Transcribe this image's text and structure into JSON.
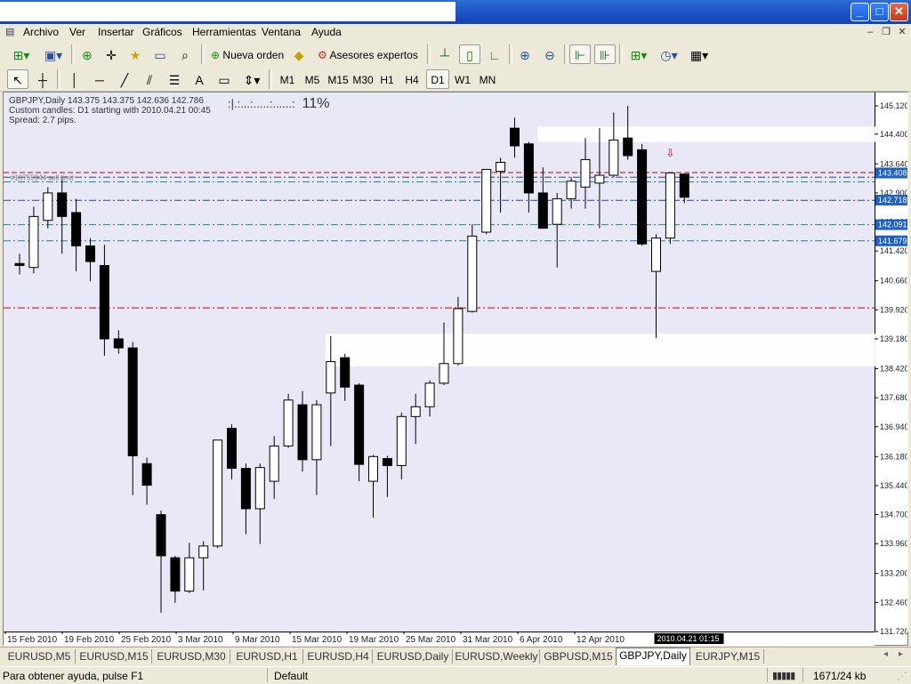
{
  "menu": [
    "Archivo",
    "Ver",
    "Insertar",
    "Gráficos",
    "Herramientas",
    "Ventana",
    "Ayuda"
  ],
  "toolbar": {
    "new_order": "Nueva orden",
    "experts": "Asesores expertos",
    "timeframes": [
      "M1",
      "M5",
      "M15",
      "M30",
      "H1",
      "H4",
      "D1",
      "W1",
      "MN"
    ],
    "active_timeframe": "D1",
    "text_tool": "A"
  },
  "chart": {
    "info_line1": "GBPJPY,Daily  143.375 143.375 142.636 142.786",
    "info_line2": "Custom candles: D1 starting with 2010.04.21 00:45",
    "info_line3": "Spread: 2.7 pips.",
    "progress_dots": ":|.:...:.....:......:",
    "progress_pct": "11%",
    "order_label": "#10755944 sell limit",
    "crosshair_time": "2010.04.21 01:15",
    "colors": {
      "background": "#e8e8f6",
      "bull": "#ffffff",
      "bear": "#000000",
      "red_line": "#cc0000",
      "teal_line": "#1a8a8a",
      "blue_line": "#2244aa",
      "highlight": "#2060c0",
      "zone": "#ffffff"
    }
  },
  "chart_data": {
    "type": "candlestick",
    "symbol": "GBPJPY",
    "timeframe": "Daily",
    "y_ticks": [
      "145.120",
      "144.400",
      "143.640",
      "142.900",
      "142.160",
      "141.420",
      "140.660",
      "139.920",
      "139.180",
      "138.420",
      "137.680",
      "136.940",
      "136.180",
      "135.440",
      "134.700",
      "133.960",
      "133.200",
      "132.460",
      "131.720"
    ],
    "x_ticks": [
      "15 Feb 2010",
      "19 Feb 2010",
      "25 Feb 2010",
      "3 Mar 2010",
      "9 Mar 2010",
      "15 Mar 2010",
      "19 Mar 2010",
      "25 Mar 2010",
      "31 Mar 2010",
      "6 Apr 2010",
      "12 Apr 2010"
    ],
    "ylim": [
      131.72,
      145.46
    ],
    "price_tags": [
      {
        "label": "143.408",
        "value": 143.408,
        "color": "#2060c0"
      },
      {
        "label": "142.718",
        "value": 142.718,
        "color": "#2060c0"
      },
      {
        "label": "142.091",
        "value": 142.091,
        "color": "#2060c0"
      },
      {
        "label": "141.679",
        "value": 141.679,
        "color": "#2060c0"
      }
    ],
    "lines": [
      {
        "value": 143.42,
        "style": "dash",
        "color": "#cc0000"
      },
      {
        "value": 143.3,
        "style": "dashdot",
        "color": "#2244aa"
      },
      {
        "value": 143.18,
        "style": "dashdot",
        "color": "#1a8a8a"
      },
      {
        "value": 142.71,
        "style": "dashdot",
        "color": "#2244aa"
      },
      {
        "value": 142.09,
        "style": "dashdot",
        "color": "#1a8a8a"
      },
      {
        "value": 141.68,
        "style": "dashdot",
        "color": "#1a8a8a"
      },
      {
        "value": 139.97,
        "style": "dashdot",
        "color": "#cc0000"
      }
    ],
    "zones": [
      {
        "from_candle": 37,
        "to_candle": 60,
        "high": 144.59,
        "low": 144.2
      },
      {
        "from_candle": 22,
        "to_candle": 60,
        "high": 139.31,
        "low": 138.48
      }
    ],
    "arrow": {
      "candle": 46,
      "value": 143.92
    },
    "candles": [
      {
        "o": 141.1,
        "h": 141.35,
        "l": 140.82,
        "c": 141.05
      },
      {
        "o": 141.0,
        "h": 142.55,
        "l": 140.85,
        "c": 142.3
      },
      {
        "o": 142.2,
        "h": 143.05,
        "l": 142.0,
        "c": 142.9
      },
      {
        "o": 142.9,
        "h": 143.25,
        "l": 141.35,
        "c": 142.3
      },
      {
        "o": 142.4,
        "h": 142.75,
        "l": 140.9,
        "c": 141.55
      },
      {
        "o": 141.55,
        "h": 141.75,
        "l": 140.65,
        "c": 141.15
      },
      {
        "o": 141.05,
        "h": 141.58,
        "l": 138.75,
        "c": 139.18
      },
      {
        "o": 139.18,
        "h": 139.4,
        "l": 138.8,
        "c": 138.95
      },
      {
        "o": 138.95,
        "h": 139.1,
        "l": 135.2,
        "c": 136.2
      },
      {
        "o": 136.0,
        "h": 136.15,
        "l": 134.95,
        "c": 135.45
      },
      {
        "o": 134.7,
        "h": 134.8,
        "l": 132.2,
        "c": 133.65
      },
      {
        "o": 133.6,
        "h": 133.65,
        "l": 132.45,
        "c": 132.75
      },
      {
        "o": 132.75,
        "h": 133.98,
        "l": 132.7,
        "c": 133.6
      },
      {
        "o": 133.6,
        "h": 134.02,
        "l": 132.77,
        "c": 133.9
      },
      {
        "o": 133.9,
        "h": 136.6,
        "l": 133.85,
        "c": 136.6
      },
      {
        "o": 136.9,
        "h": 137.0,
        "l": 135.6,
        "c": 135.88
      },
      {
        "o": 135.88,
        "h": 136.0,
        "l": 134.2,
        "c": 134.85
      },
      {
        "o": 134.85,
        "h": 136.0,
        "l": 133.95,
        "c": 135.9
      },
      {
        "o": 135.55,
        "h": 136.7,
        "l": 135.1,
        "c": 136.45
      },
      {
        "o": 136.45,
        "h": 137.78,
        "l": 136.4,
        "c": 137.62
      },
      {
        "o": 137.5,
        "h": 137.85,
        "l": 135.8,
        "c": 136.1
      },
      {
        "o": 136.1,
        "h": 137.62,
        "l": 135.2,
        "c": 137.5
      },
      {
        "o": 137.8,
        "h": 139.25,
        "l": 136.45,
        "c": 138.6
      },
      {
        "o": 138.7,
        "h": 138.8,
        "l": 137.6,
        "c": 137.95
      },
      {
        "o": 138.0,
        "h": 138.05,
        "l": 135.55,
        "c": 135.98
      },
      {
        "o": 135.55,
        "h": 136.22,
        "l": 134.62,
        "c": 136.18
      },
      {
        "o": 136.13,
        "h": 136.2,
        "l": 135.15,
        "c": 135.95
      },
      {
        "o": 135.95,
        "h": 137.3,
        "l": 135.6,
        "c": 137.2
      },
      {
        "o": 137.2,
        "h": 137.78,
        "l": 136.5,
        "c": 137.45
      },
      {
        "o": 137.45,
        "h": 138.12,
        "l": 137.2,
        "c": 138.05
      },
      {
        "o": 138.05,
        "h": 139.6,
        "l": 138.0,
        "c": 138.55
      },
      {
        "o": 138.55,
        "h": 140.25,
        "l": 138.5,
        "c": 139.95
      },
      {
        "o": 139.88,
        "h": 142.1,
        "l": 139.85,
        "c": 141.8
      },
      {
        "o": 141.9,
        "h": 143.5,
        "l": 141.85,
        "c": 143.5
      },
      {
        "o": 143.45,
        "h": 143.8,
        "l": 142.4,
        "c": 143.68
      },
      {
        "o": 144.55,
        "h": 144.82,
        "l": 143.8,
        "c": 144.1
      },
      {
        "o": 144.15,
        "h": 144.2,
        "l": 142.4,
        "c": 142.9
      },
      {
        "o": 142.9,
        "h": 143.55,
        "l": 142.0,
        "c": 142.0
      },
      {
        "o": 142.1,
        "h": 142.9,
        "l": 141.0,
        "c": 142.75
      },
      {
        "o": 142.75,
        "h": 143.3,
        "l": 142.5,
        "c": 143.2
      },
      {
        "o": 143.05,
        "h": 144.3,
        "l": 142.5,
        "c": 143.75
      },
      {
        "o": 143.15,
        "h": 144.55,
        "l": 142.0,
        "c": 143.35
      },
      {
        "o": 143.35,
        "h": 144.95,
        "l": 143.3,
        "c": 144.25
      },
      {
        "o": 144.3,
        "h": 145.12,
        "l": 143.75,
        "c": 143.85
      },
      {
        "o": 144.0,
        "h": 144.15,
        "l": 141.55,
        "c": 141.6
      },
      {
        "o": 140.9,
        "h": 141.85,
        "l": 139.2,
        "c": 141.75
      },
      {
        "o": 141.75,
        "h": 143.41,
        "l": 141.6,
        "c": 143.41
      },
      {
        "o": 143.38,
        "h": 143.38,
        "l": 142.64,
        "c": 142.79
      }
    ]
  },
  "tabs": [
    "EURUSD,M5",
    "EURUSD,M15",
    "EURUSD,M30",
    "EURUSD,H1",
    "EURUSD,H4",
    "EURUSD,Daily",
    "EURUSD,Weekly",
    "GBPUSD,M15",
    "GBPJPY,Daily",
    "EURJPY,M15"
  ],
  "active_tab": "GBPJPY,Daily",
  "status": {
    "help": "Para obtener ayuda, pulse F1",
    "profile": "Default",
    "traffic": "1671/24 kb"
  }
}
